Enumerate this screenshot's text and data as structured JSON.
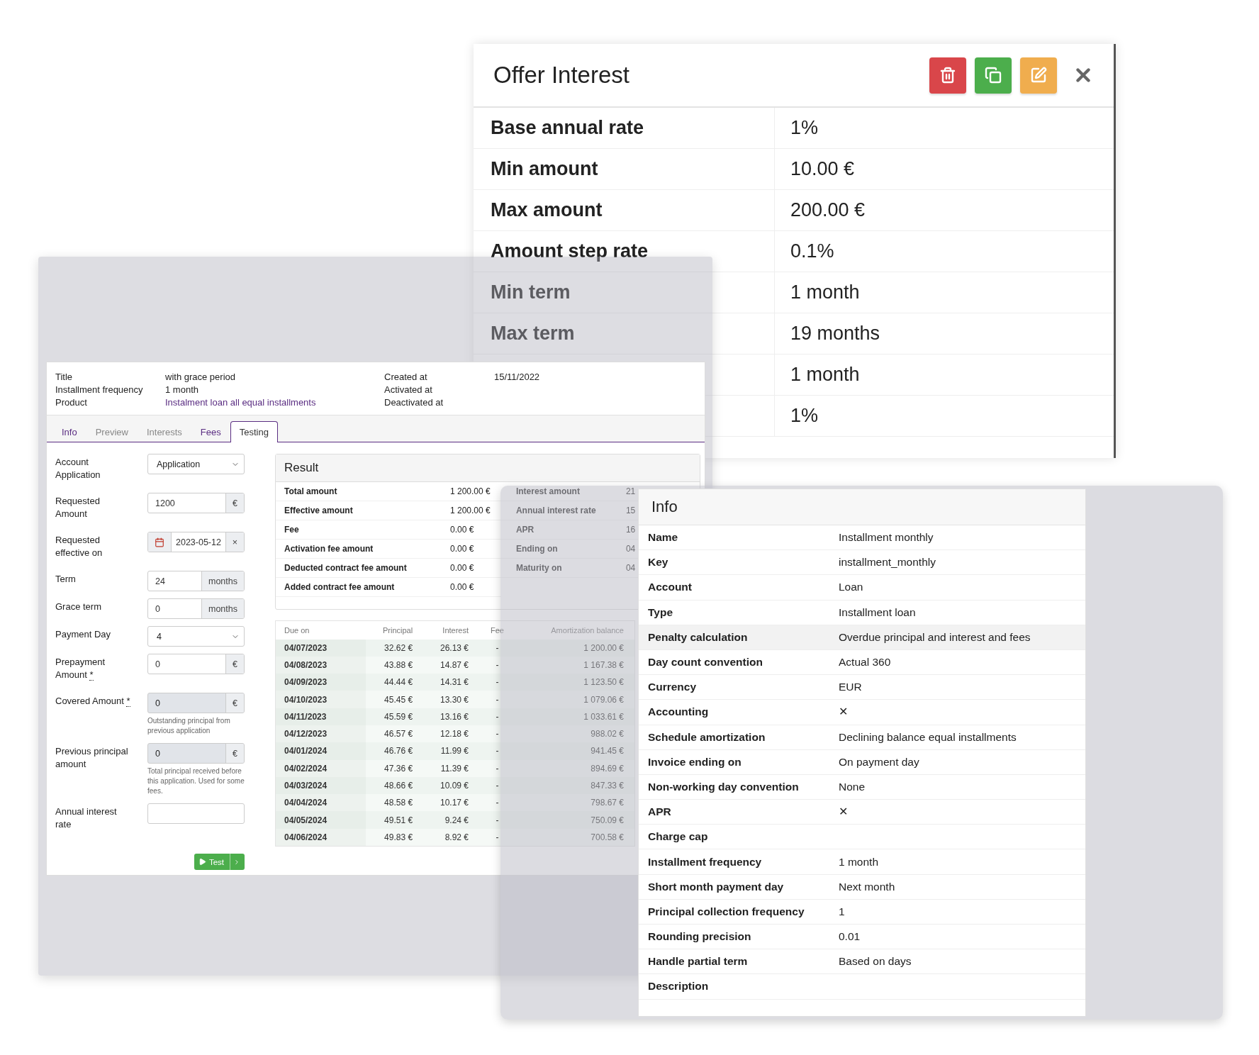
{
  "offer_panel": {
    "title": "Offer Interest",
    "actions": [
      {
        "kind": "delete"
      },
      {
        "kind": "copy"
      },
      {
        "kind": "edit"
      }
    ],
    "rows": [
      {
        "label": "Base annual rate",
        "value": "1%"
      },
      {
        "label": "Min amount",
        "value": "10.00 €"
      },
      {
        "label": "Max amount",
        "value": "200.00 €"
      },
      {
        "label": "Amount step rate",
        "value": "0.1%"
      },
      {
        "label": "Min term",
        "value": "1 month"
      },
      {
        "label": "Max term",
        "value": "19 months"
      },
      {
        "value": "1 month"
      },
      {
        "value": "1%"
      }
    ]
  },
  "product": {
    "fields": [
      {
        "label": "Title",
        "value": "with grace period",
        "link": false
      },
      {
        "label": "Installment frequency",
        "value": "1 month",
        "link": false
      },
      {
        "label": "Product",
        "value": "Instalment loan all equal installments",
        "link": true
      }
    ],
    "dates": [
      {
        "label": "Created at",
        "value": "15/11/2022"
      },
      {
        "label": "Activated at"
      },
      {
        "label": "Deactivated at"
      }
    ]
  },
  "tabs": [
    {
      "label": "Info",
      "selected": false,
      "disabled": false
    },
    {
      "label": "Preview",
      "selected": false,
      "disabled": true
    },
    {
      "label": "Interests",
      "selected": false,
      "disabled": true
    },
    {
      "label": "Fees",
      "selected": false,
      "disabled": false
    },
    {
      "label": "Testing",
      "selected": true,
      "disabled": false
    }
  ],
  "form": {
    "fields": [
      {
        "kind": "select",
        "label": "Account Application",
        "value": "Application"
      },
      {
        "kind": "addon",
        "label": "Requested Amount",
        "value": "1200",
        "addon": "€",
        "disabled": false
      },
      {
        "kind": "date",
        "label": "Requested effective on",
        "value": "2023-05-12",
        "clear": "×"
      },
      {
        "kind": "addon",
        "label": "Term",
        "value": "24",
        "addon": "months",
        "disabled": false
      },
      {
        "kind": "addon",
        "label": "Grace term",
        "value": "0",
        "addon": "months",
        "disabled": false
      },
      {
        "kind": "select",
        "label": "Payment Day",
        "value": "4"
      },
      {
        "kind": "addon",
        "label": "Prepayment Amount",
        "required_mark": "*",
        "value": "0",
        "addon": "€",
        "disabled": false
      },
      {
        "kind": "addon",
        "label": "Covered Amount",
        "required_mark": "*",
        "value": "0",
        "addon": "€",
        "disabled": true,
        "help": "Outstanding principal from previous application"
      },
      {
        "kind": "addon",
        "label": "Previous principal amount",
        "value": "0",
        "addon": "€",
        "disabled": true,
        "help": "Total principal received before this application. Used for some fees."
      },
      {
        "kind": "text",
        "label": "Annual interest rate"
      }
    ],
    "submit": "Test"
  },
  "result": {
    "title": "Result",
    "left": [
      {
        "label": "Total amount",
        "value": "1 200.00 €"
      },
      {
        "label": "Effective amount",
        "value": "1 200.00 €"
      },
      {
        "label": "Fee",
        "value": "0.00 €"
      },
      {
        "label": "Activation fee amount",
        "value": "0.00 €"
      },
      {
        "label": "Deducted contract fee amount",
        "value": "0.00 €"
      },
      {
        "label": "Added contract fee amount",
        "value": "0.00 €"
      }
    ],
    "right": [
      {
        "label": "Interest amount",
        "value": "21"
      },
      {
        "label": "Annual interest rate",
        "value": "15"
      },
      {
        "label": "APR",
        "value": "16"
      },
      {
        "label": "Ending on",
        "value": "04"
      },
      {
        "label": "Maturity on",
        "value": "04"
      }
    ]
  },
  "schedule": {
    "columns": [
      "Due on",
      "Principal",
      "Interest",
      "Fee",
      "Amortization balance"
    ],
    "rows": [
      [
        "04/07/2023",
        "32.62 €",
        "26.13 €",
        "-",
        "1 200.00 €"
      ],
      [
        "04/08/2023",
        "43.88 €",
        "14.87 €",
        "-",
        "1 167.38 €"
      ],
      [
        "04/09/2023",
        "44.44 €",
        "14.31 €",
        "-",
        "1 123.50 €"
      ],
      [
        "04/10/2023",
        "45.45 €",
        "13.30 €",
        "-",
        "1 079.06 €"
      ],
      [
        "04/11/2023",
        "45.59 €",
        "13.16 €",
        "-",
        "1 033.61 €"
      ],
      [
        "04/12/2023",
        "46.57 €",
        "12.18 €",
        "-",
        "988.02 €"
      ],
      [
        "04/01/2024",
        "46.76 €",
        "11.99 €",
        "-",
        "941.45 €"
      ],
      [
        "04/02/2024",
        "47.36 €",
        "11.39 €",
        "-",
        "894.69 €"
      ],
      [
        "04/03/2024",
        "48.66 €",
        "10.09 €",
        "-",
        "847.33 €"
      ],
      [
        "04/04/2024",
        "48.58 €",
        "10.17 €",
        "-",
        "798.67 €"
      ],
      [
        "04/05/2024",
        "49.51 €",
        "9.24 €",
        "-",
        "750.09 €"
      ],
      [
        "04/06/2024",
        "49.83 €",
        "8.92 €",
        "-",
        "700.58 €"
      ]
    ]
  },
  "info_panel": {
    "title": "Info",
    "rows": [
      {
        "label": "Name",
        "value": "Installment monthly",
        "highlighted": false
      },
      {
        "label": "Key",
        "value": "installment_monthly",
        "highlighted": false
      },
      {
        "label": "Account",
        "value": "Loan",
        "highlighted": false
      },
      {
        "label": "Type",
        "value": "Installment loan",
        "highlighted": false
      },
      {
        "label": "Penalty calculation",
        "value": "Overdue principal and interest and fees",
        "highlighted": true
      },
      {
        "label": "Day count convention",
        "value": "Actual 360",
        "highlighted": false
      },
      {
        "label": "Currency",
        "value": "EUR",
        "highlighted": false
      },
      {
        "label": "Accounting",
        "value": "✕",
        "highlighted": false
      },
      {
        "label": "Schedule amortization",
        "value": "Declining balance equal installments",
        "highlighted": false
      },
      {
        "label": "Invoice ending on",
        "value": "On payment day",
        "highlighted": false
      },
      {
        "label": "Non-working day convention",
        "value": "None",
        "highlighted": false
      },
      {
        "label": "APR",
        "value": "✕",
        "highlighted": false
      },
      {
        "label": "Charge cap",
        "highlighted": false
      },
      {
        "label": "Installment frequency",
        "value": "1 month",
        "highlighted": false
      },
      {
        "label": "Short month payment day",
        "value": "Next month",
        "highlighted": false
      },
      {
        "label": "Principal collection frequency",
        "value": "1",
        "highlighted": false
      },
      {
        "label": "Rounding precision",
        "value": "0.01",
        "highlighted": false
      },
      {
        "label": "Handle partial term",
        "value": "Based on days",
        "highlighted": false
      },
      {
        "label": "Description",
        "highlighted": false
      }
    ]
  }
}
